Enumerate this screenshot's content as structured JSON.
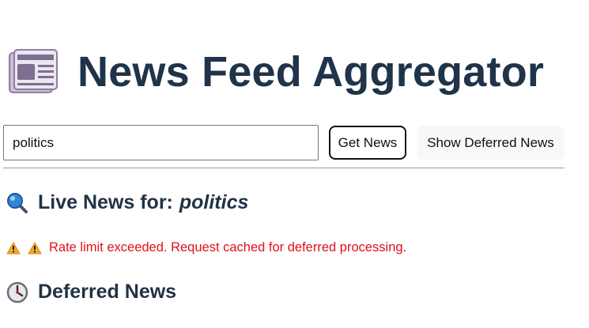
{
  "header": {
    "title": "News Feed Aggregator",
    "logo_icon": "newspaper-icon"
  },
  "search": {
    "value": "politics",
    "placeholder": ""
  },
  "buttons": {
    "get_news": "Get News",
    "show_deferred": "Show Deferred News"
  },
  "live_section": {
    "icon": "magnifier-icon",
    "heading": "Live News for:",
    "query": "politics"
  },
  "warning": {
    "icons": [
      "warning-icon",
      "warning-icon"
    ],
    "message": "Rate limit exceeded. Request cached for deferred processing."
  },
  "deferred_section": {
    "icon": "clock-icon",
    "heading": "Deferred News"
  },
  "colors": {
    "title": "#1f3349",
    "warning_text": "#e0101a",
    "divider": "#999999"
  }
}
